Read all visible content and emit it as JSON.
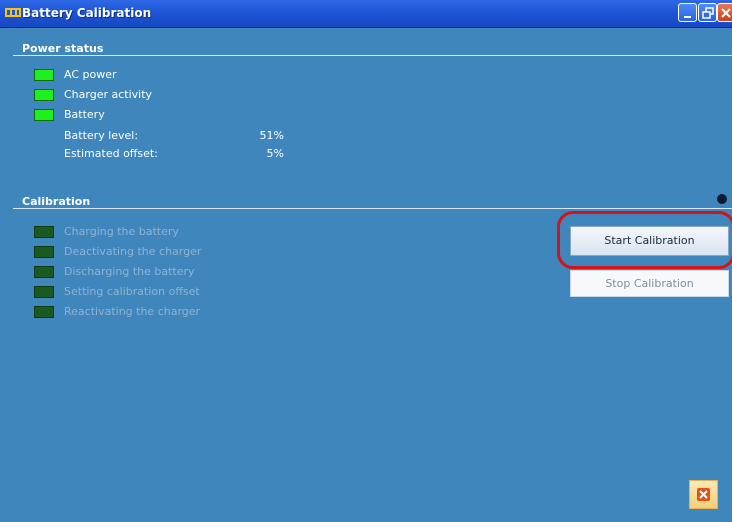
{
  "window": {
    "title": "Battery Calibration",
    "controls": {
      "minimize": "minimize-icon",
      "restore": "restore-icon",
      "close": "close-icon"
    }
  },
  "power_status": {
    "title": "Power status",
    "indicators": [
      {
        "label": "AC power",
        "state": "on"
      },
      {
        "label": "Charger activity",
        "state": "on"
      },
      {
        "label": "Battery",
        "state": "on"
      }
    ],
    "battery_level_label": "Battery level:",
    "battery_level_value": "51%",
    "estimated_offset_label": "Estimated offset:",
    "estimated_offset_value": "5%"
  },
  "calibration": {
    "title": "Calibration",
    "steps": [
      {
        "label": "Charging the battery",
        "state": "off"
      },
      {
        "label": "Deactivating the charger",
        "state": "off"
      },
      {
        "label": "Discharging the battery",
        "state": "off"
      },
      {
        "label": "Setting calibration offset",
        "state": "off"
      },
      {
        "label": "Reactivating the charger",
        "state": "off"
      }
    ],
    "start_button": "Start Calibration",
    "stop_button": "Stop Calibration"
  },
  "colors": {
    "background": "#3f86bd",
    "led_on": "#1ef01e",
    "led_off": "#1a5a21",
    "highlight": "#d2141a"
  }
}
